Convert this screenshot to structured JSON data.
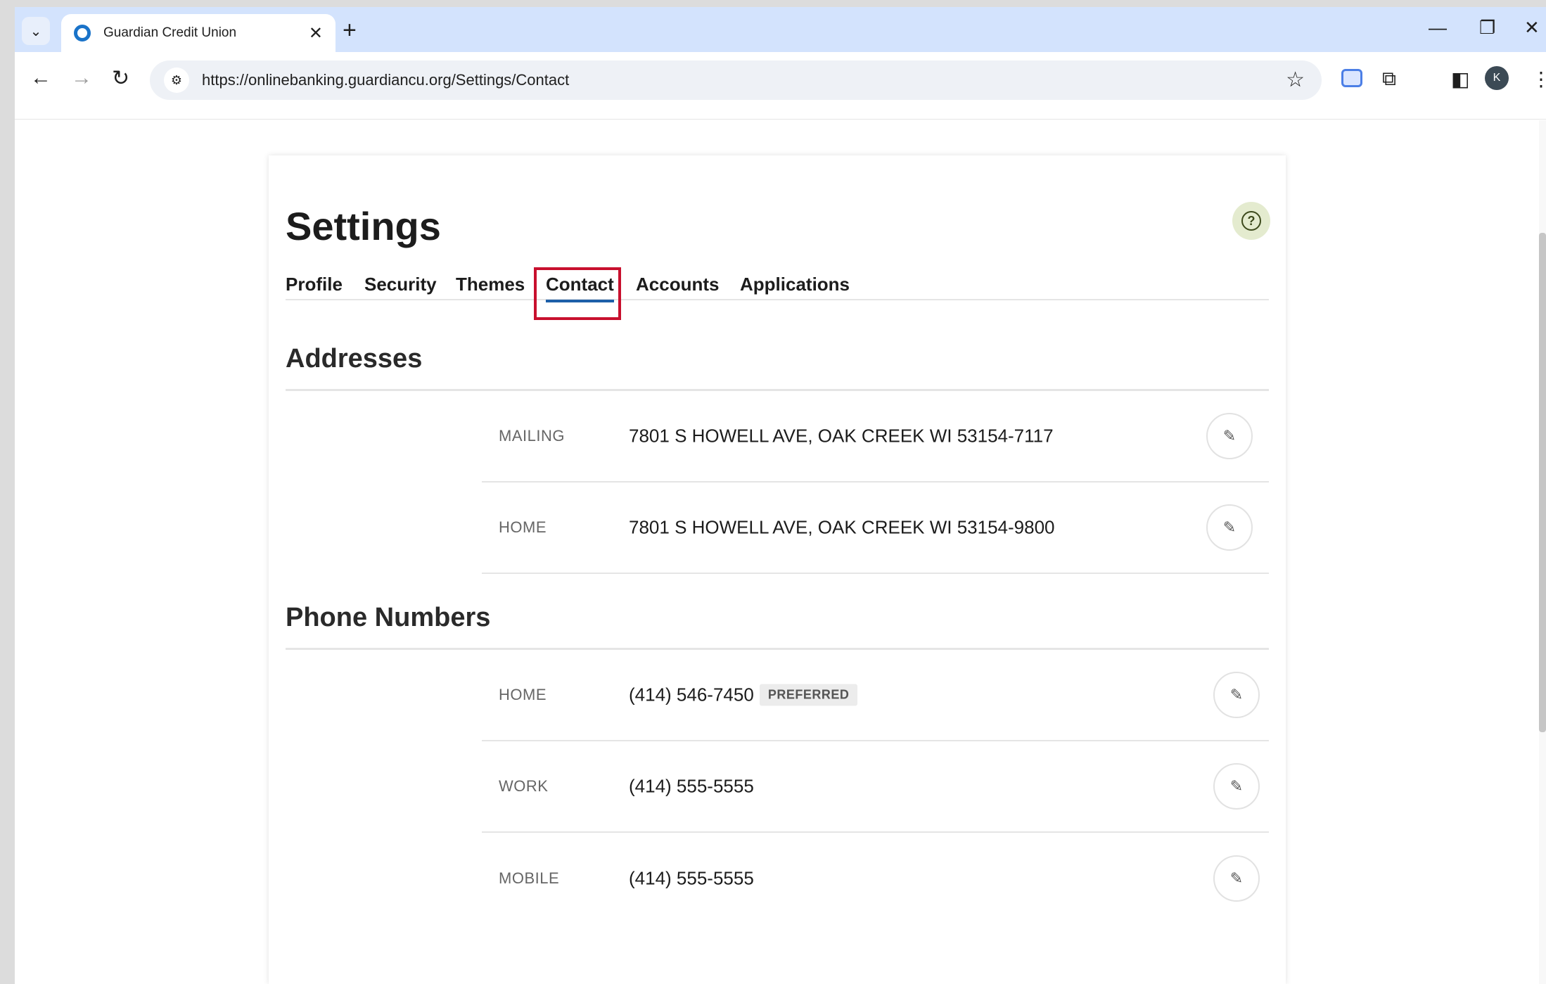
{
  "browser": {
    "tab_title": "Guardian Credit Union",
    "url": "https://onlinebanking.guardiancu.org/Settings/Contact",
    "profile_initial": "K"
  },
  "page": {
    "title": "Settings",
    "tabs": [
      "Profile",
      "Security",
      "Themes",
      "Contact",
      "Accounts",
      "Applications"
    ],
    "active_tab": "Contact"
  },
  "addresses": {
    "title": "Addresses",
    "rows": [
      {
        "label": "MAILING",
        "value": "7801 S HOWELL AVE, OAK CREEK WI 53154-7117"
      },
      {
        "label": "HOME",
        "value": "7801 S HOWELL AVE, OAK CREEK WI 53154-9800"
      }
    ]
  },
  "phones": {
    "title": "Phone Numbers",
    "rows": [
      {
        "label": "HOME",
        "value": "(414) 546-7450",
        "badge": "PREFERRED"
      },
      {
        "label": "WORK",
        "value": "(414) 555-5555"
      },
      {
        "label": "MOBILE",
        "value": "(414) 555-5555"
      }
    ]
  },
  "colors": {
    "highlight": "#c8102e",
    "active_underline": "#1d5fa8",
    "help_bg": "#e4ebcf"
  }
}
